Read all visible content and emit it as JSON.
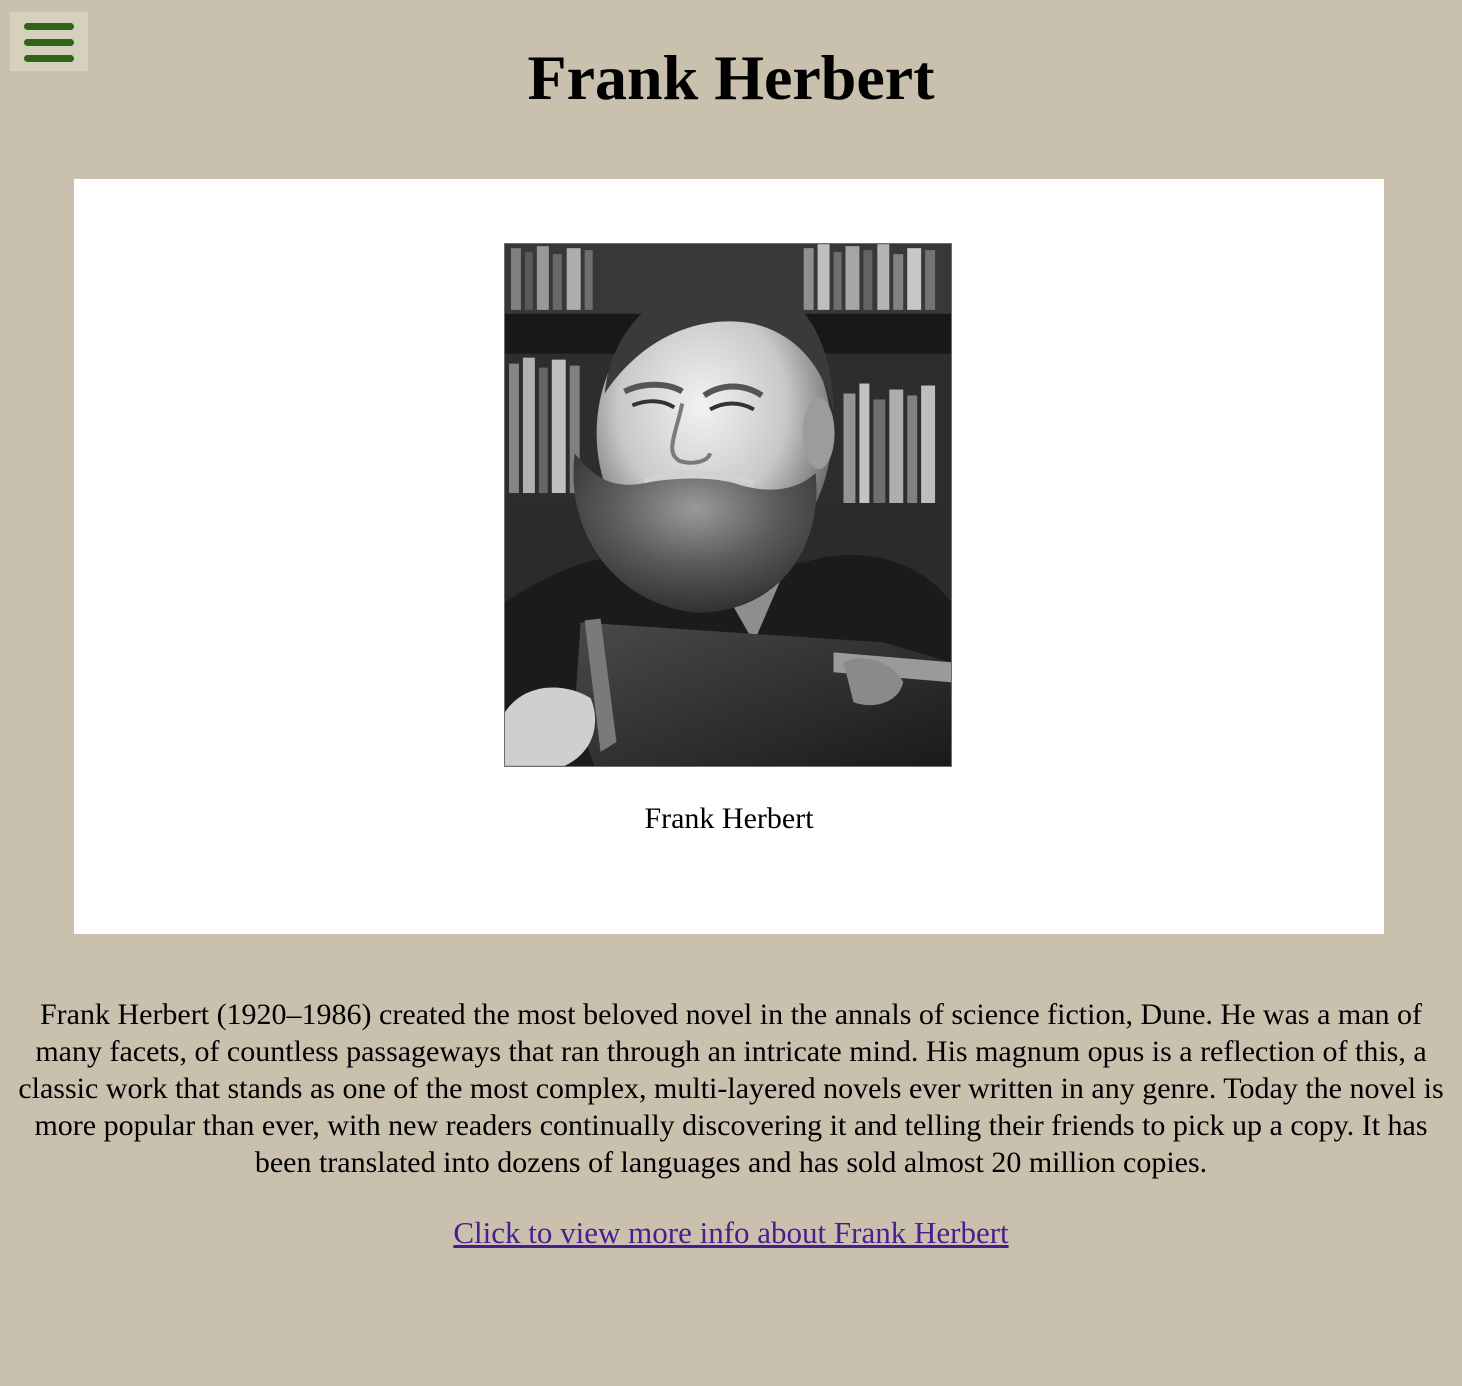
{
  "menu": {
    "icon": "hamburger-menu-icon",
    "color": "#2f6515"
  },
  "header": {
    "title": "Frank Herbert"
  },
  "figure": {
    "image": "frank-herbert-portrait",
    "caption": "Frank Herbert"
  },
  "bio": {
    "text": "Frank Herbert (1920–1986) created the most beloved novel in the annals of science fiction, Dune. He was a man of many facets, of countless passageways that ran through an intricate mind. His magnum opus is a reflection of this, a classic work that stands as one of the most complex, multi-layered novels ever written in any genre. Today the novel is more popular than ever, with new readers continually discovering it and telling their friends to pick up a copy. It has been translated into dozens of languages and has sold almost 20 million copies."
  },
  "link": {
    "label": "Click to view more info about Frank Herbert",
    "color": "#4b1d8c"
  },
  "colors": {
    "background": "#c9c1ae",
    "card": "#ffffff"
  }
}
